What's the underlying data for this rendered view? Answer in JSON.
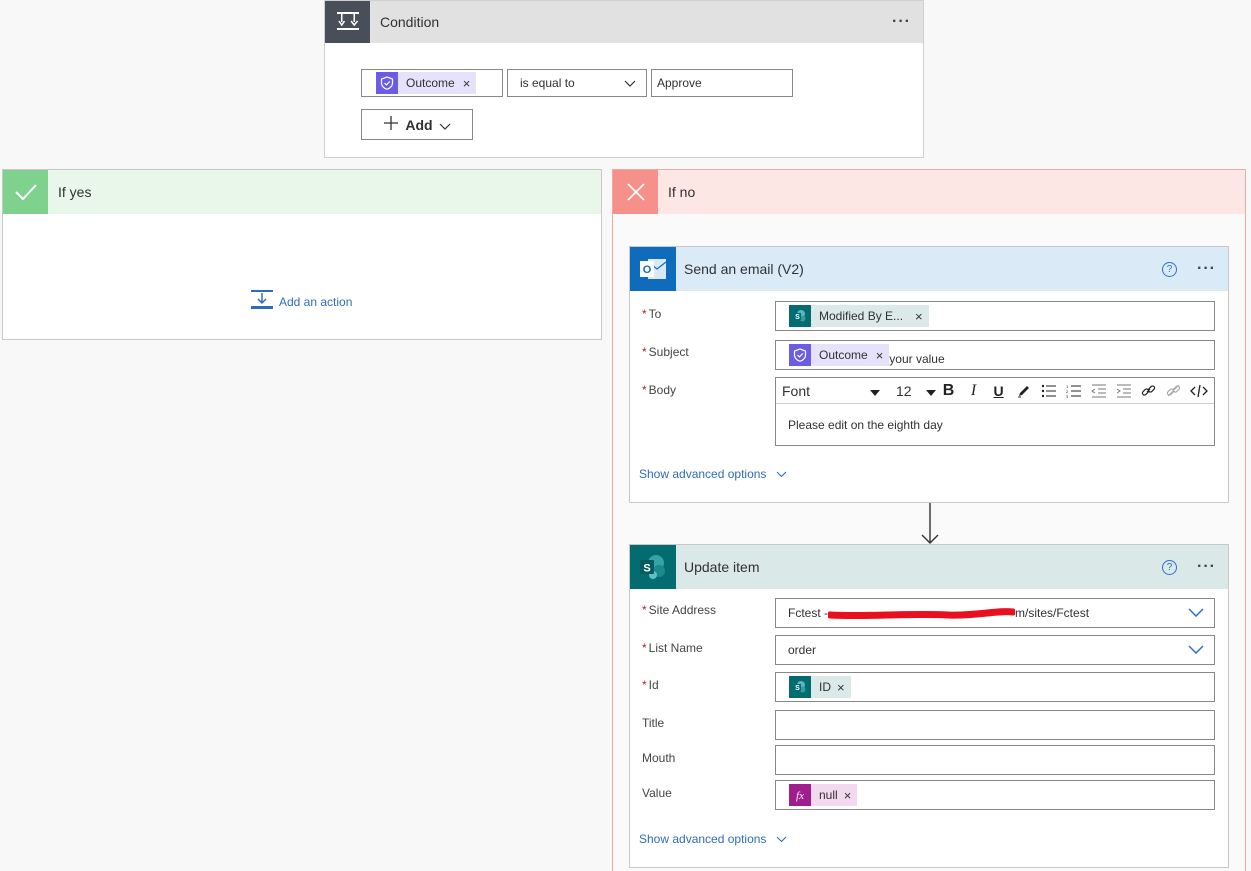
{
  "condition": {
    "title": "Condition",
    "menu": "···",
    "token_label": "Outcome",
    "token_remove": "×",
    "operator": "is equal to",
    "value": "Approve",
    "add_label": "Add"
  },
  "yes_branch": {
    "title": "If yes",
    "add_action": "Add an action"
  },
  "no_branch": {
    "title": "If no",
    "email": {
      "title": "Send an email (V2)",
      "help": "?",
      "menu": "···",
      "to_label": "To",
      "to_token": "Modified By E...",
      "subject_label": "Subject",
      "subject_token": "Outcome",
      "subject_text": "your value",
      "body_label": "Body",
      "font": "Font",
      "font_size": "12",
      "body_text": "Please edit on the eighth day",
      "show_advanced": "Show advanced options",
      "required_mark": "*",
      "token_remove": "×"
    },
    "update": {
      "title": "Update item",
      "help": "?",
      "menu": "···",
      "site_label": "Site Address",
      "site_value_prefix": "Fctest -",
      "site_value_suffix": "m/sites/Fctest",
      "list_label": "List Name",
      "list_value": "order",
      "id_label": "Id",
      "id_token": "ID",
      "title_label": "Title",
      "mouth_label": "Mouth",
      "value_label": "Value",
      "value_token": "null",
      "show_advanced": "Show advanced options",
      "required_mark": "*",
      "token_remove": "×"
    }
  },
  "colors": {
    "condition_icon_bg": "#484f58",
    "yes_bg": "#e9f7ea",
    "yes_icon": "#7fd28e",
    "no_bg": "#fde7e5",
    "no_icon": "#f5918a",
    "email_header": "#dbeaf7",
    "update_header": "#dae8e8",
    "link": "#2f6dba",
    "sharepoint": "#036c70",
    "fx": "#a01d8e",
    "redaction": "#e8101e"
  }
}
